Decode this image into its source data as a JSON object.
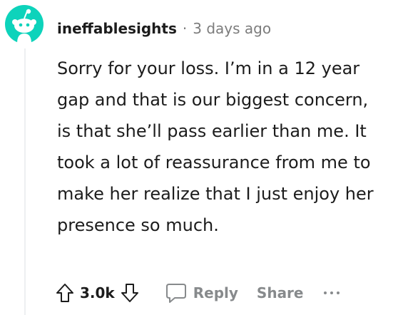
{
  "comment": {
    "author": "ineffablesights",
    "separator": "·",
    "time_ago": "3 days ago",
    "body": "Sorry for your loss. I’m in a 12 year gap and that is our biggest concern, is that she’ll pass earlier than me. It took a lot of reassurance from me to make her realize that I just enjoy her presence so much.",
    "avatar_icon": "snoo-avatar-icon",
    "avatar_color": "#0dd3bb"
  },
  "actions": {
    "upvote_icon": "upvote-arrow-icon",
    "vote_count": "3.0k",
    "downvote_icon": "downvote-arrow-icon",
    "reply_icon": "speech-bubble-icon",
    "reply_label": "Reply",
    "share_label": "Share",
    "more_icon": "ellipsis-icon"
  }
}
